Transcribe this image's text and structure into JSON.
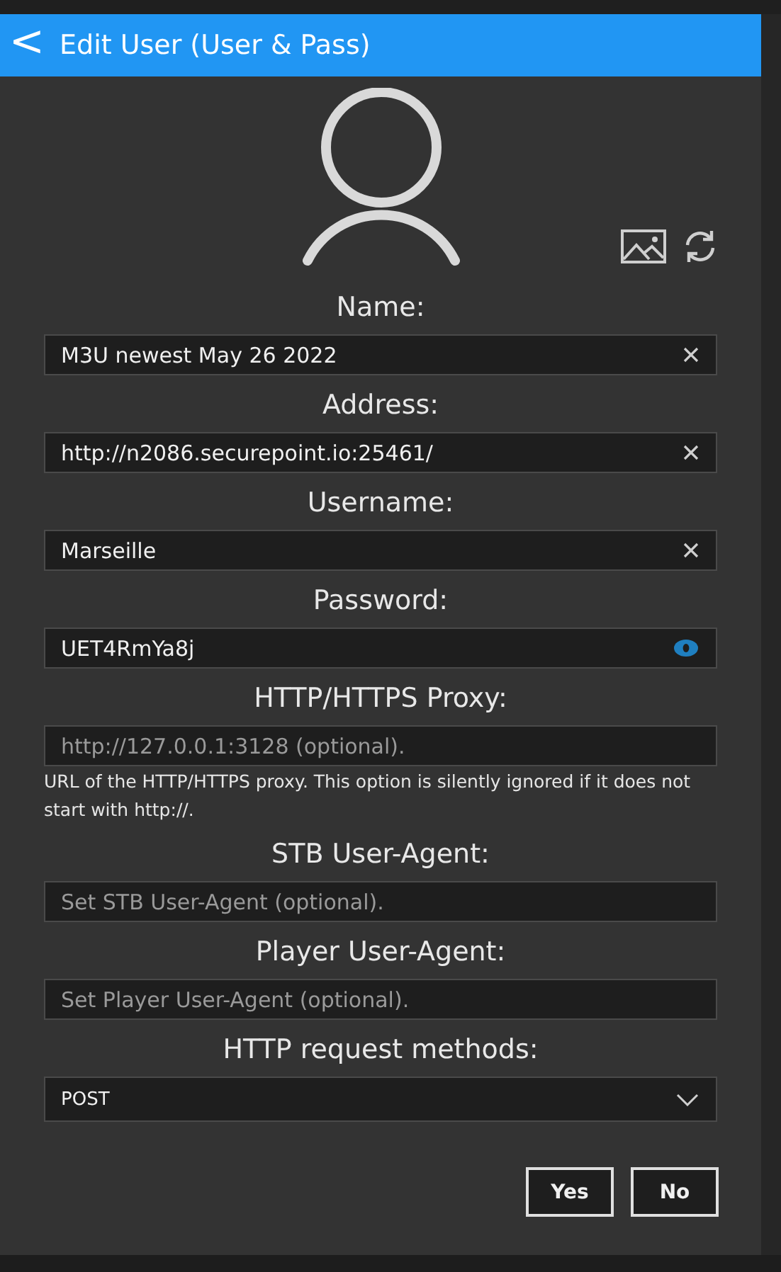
{
  "header": {
    "back": "<",
    "title": "Edit User (User & Pass)"
  },
  "fields": [
    {
      "label": "Name:",
      "kind": "text",
      "value": "M3U newest May 26 2022"
    },
    {
      "label": "Address:",
      "kind": "text",
      "value": "http://n2086.securepoint.io:25461/"
    },
    {
      "label": "Username:",
      "kind": "text",
      "value": "Marseille"
    },
    {
      "label": "Password:",
      "kind": "password",
      "value": "UET4RmYa8j"
    },
    {
      "label": "HTTP/HTTPS Proxy:",
      "kind": "empty",
      "placeholder": "http://127.0.0.1:3128 (optional).",
      "help": "URL of the HTTP/HTTPS proxy. This option is silently ignored if it does not start with http://."
    },
    {
      "label": "STB User-Agent:",
      "kind": "empty",
      "placeholder": "Set STB User-Agent (optional)."
    },
    {
      "label": "Player User-Agent:",
      "kind": "empty",
      "placeholder": "Set Player User-Agent (optional)."
    },
    {
      "label": "HTTP request methods:",
      "kind": "select",
      "value": "POST"
    }
  ],
  "buttons": [
    "Yes",
    "No"
  ]
}
